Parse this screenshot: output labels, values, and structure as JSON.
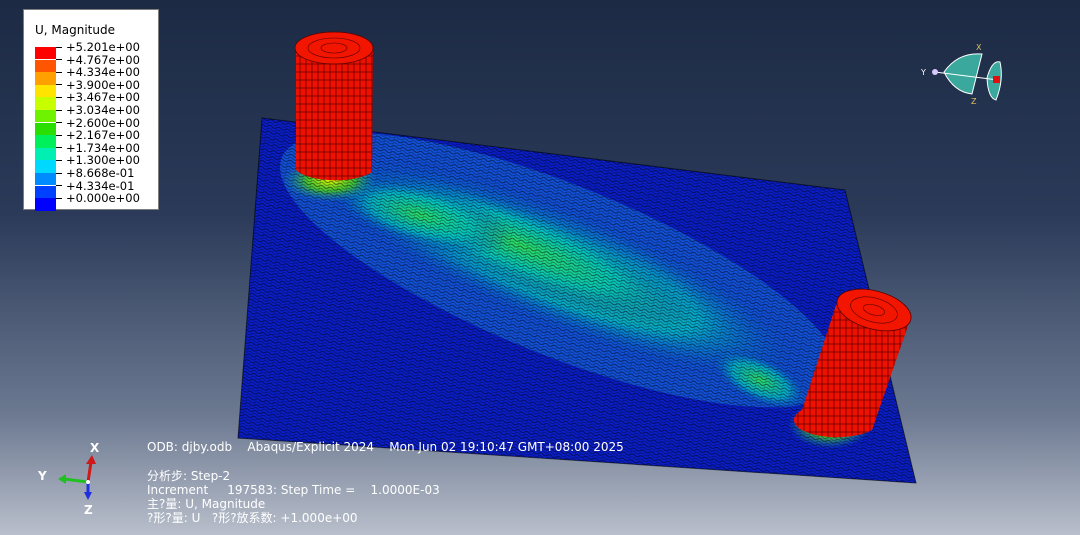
{
  "legend": {
    "title": "U, Magnitude",
    "entries": [
      {
        "label": "+5.201e+00",
        "color": "#ff0000"
      },
      {
        "label": "+4.767e+00",
        "color": "#ff5500"
      },
      {
        "label": "+4.334e+00",
        "color": "#ff9f00"
      },
      {
        "label": "+3.900e+00",
        "color": "#ffe400"
      },
      {
        "label": "+3.467e+00",
        "color": "#c8ff00"
      },
      {
        "label": "+3.034e+00",
        "color": "#6ef200"
      },
      {
        "label": "+2.600e+00",
        "color": "#2ade00"
      },
      {
        "label": "+2.167e+00",
        "color": "#00f05c"
      },
      {
        "label": "+1.734e+00",
        "color": "#00f0b4"
      },
      {
        "label": "+1.300e+00",
        "color": "#00d9ff"
      },
      {
        "label": "+8.668e-01",
        "color": "#008cff"
      },
      {
        "label": "+4.334e-01",
        "color": "#0040ff"
      },
      {
        "label": "+0.000e+00",
        "color": "#0000ff"
      }
    ]
  },
  "info": {
    "line1": "ODB: djby.odb    Abaqus/Explicit 2024    Mon Jun 02 19:10:47 GMT+08:00 2025",
    "line2": "分析步: Step-2",
    "line3": "Increment     197583: Step Time =    1.0000E-03",
    "line4": "主?量: U, Magnitude",
    "line5": "?形?量: U   ?形?放系数: +1.000e+00"
  },
  "triad": {
    "x": "X",
    "y": "Y",
    "z": "Z"
  },
  "view_cube": {
    "x": "X",
    "y": "Y",
    "z": "Z"
  },
  "colors": {
    "cylinder": "#ee1100",
    "mesh_low": "#0a1ec8",
    "background_top": "#1c2a44"
  }
}
